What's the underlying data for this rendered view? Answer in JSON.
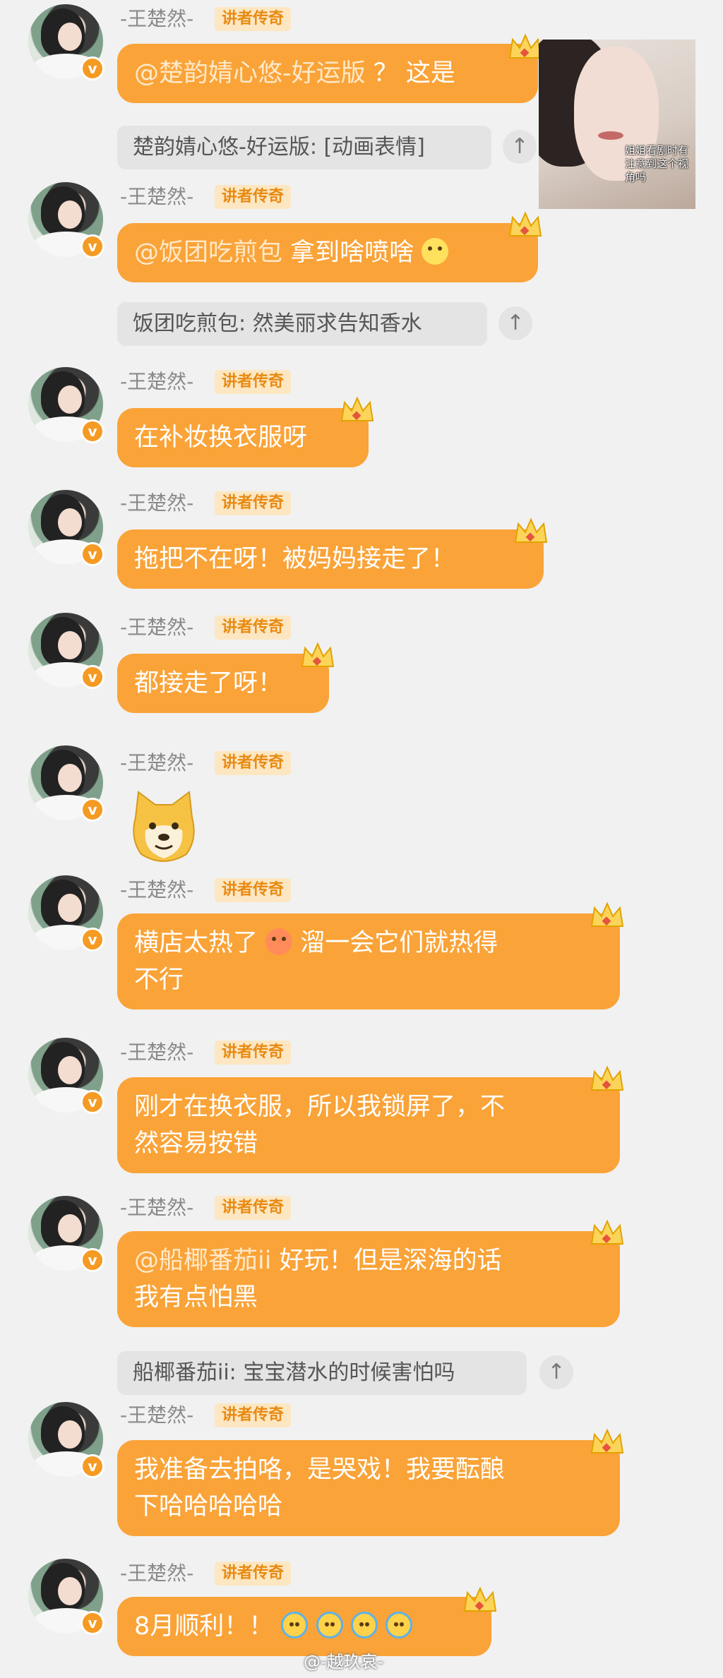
{
  "messages": [
    {
      "name": "-王楚然-",
      "badge": "讲者传奇",
      "mention": "@楚韵婧心悠-好运版",
      "text": "？ 这是",
      "reply": "楚韵婧心悠-好运版: [动画表情]"
    },
    {
      "name": "-王楚然-",
      "badge": "讲者传奇",
      "mention": "@饭团吃煎包",
      "text": "拿到啥喷啥",
      "reply": "饭团吃煎包: 然美丽求告知香水"
    },
    {
      "name": "-王楚然-",
      "badge": "讲者传奇",
      "text": "在补妆换衣服呀"
    },
    {
      "name": "-王楚然-",
      "badge": "讲者传奇",
      "text": "拖把不在呀！被妈妈接走了！"
    },
    {
      "name": "-王楚然-",
      "badge": "讲者传奇",
      "text": "都接走了呀！"
    },
    {
      "name": "-王楚然-",
      "badge": "讲者传奇"
    },
    {
      "name": "-王楚然-",
      "badge": "讲者传奇",
      "text_a": "横店太热了",
      "text_b": "溜一会它们就热得",
      "text_c": "不行"
    },
    {
      "name": "-王楚然-",
      "badge": "讲者传奇",
      "text_a": "刚才在换衣服，所以我锁屏了，不",
      "text_b": "然容易按错"
    },
    {
      "name": "-王楚然-",
      "badge": "讲者传奇",
      "mention": "@船椰番茄ii",
      "text_a": "好玩！但是深海的话",
      "text_b": "我有点怕黑",
      "reply": "船椰番茄ii: 宝宝潜水的时候害怕吗"
    },
    {
      "name": "-王楚然-",
      "badge": "讲者传奇",
      "text_a": "我准备去拍咯，是哭戏！我要酝酿",
      "text_b": "下哈哈哈哈哈"
    },
    {
      "name": "-王楚然-",
      "badge": "讲者传奇",
      "text": "8月顺利！！"
    }
  ],
  "photo_caption": "姐姐看剧时有注意到这个视角吗",
  "top_icon": "↑",
  "verified_mark": "v",
  "watermark": "@-越玖哀-",
  "colors": {
    "bubble": "#faa338",
    "badge_bg": "#fde7c2",
    "badge_text": "#e88a12"
  }
}
